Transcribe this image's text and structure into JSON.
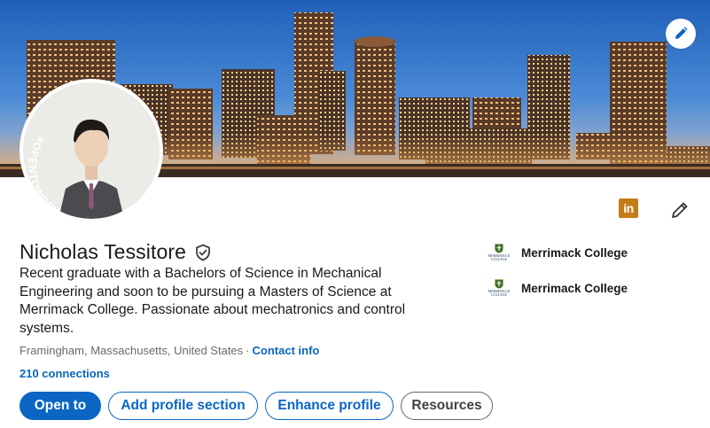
{
  "profile": {
    "name": "Nicholas Tessitore",
    "headline": "Recent graduate with a Bachelors of Science in Mechanical Engineering and soon to be pursuing a Masters of Science at Merrimack College. Passionate about mechatronics and control systems.",
    "location": "Framingham, Massachusetts, United States",
    "location_separator": "·",
    "contact_info_label": "Contact info",
    "connections_label": "210 connections",
    "open_to_work_frame": "#OPENTOWORK",
    "linkedin_badge_text": "in"
  },
  "actions": {
    "open_to": "Open to",
    "add_profile_section": "Add profile section",
    "enhance_profile": "Enhance profile",
    "resources": "Resources"
  },
  "education": [
    {
      "school": "Merrimack College",
      "logo_caption": "MERRIMACK COLLEGE"
    },
    {
      "school": "Merrimack College",
      "logo_caption": "MERRIMACK COLLEGE"
    }
  ],
  "icons": {
    "banner_edit": "pencil-icon",
    "intro_edit": "pencil-icon",
    "verification": "shield-check-icon",
    "linkedin": "linkedin-icon",
    "school_logo": "merrimack-crest-icon"
  },
  "colors": {
    "accent": "#0a66c2",
    "open_to_work_green": "#3e7d37",
    "linkedin_badge": "#c37d16"
  }
}
